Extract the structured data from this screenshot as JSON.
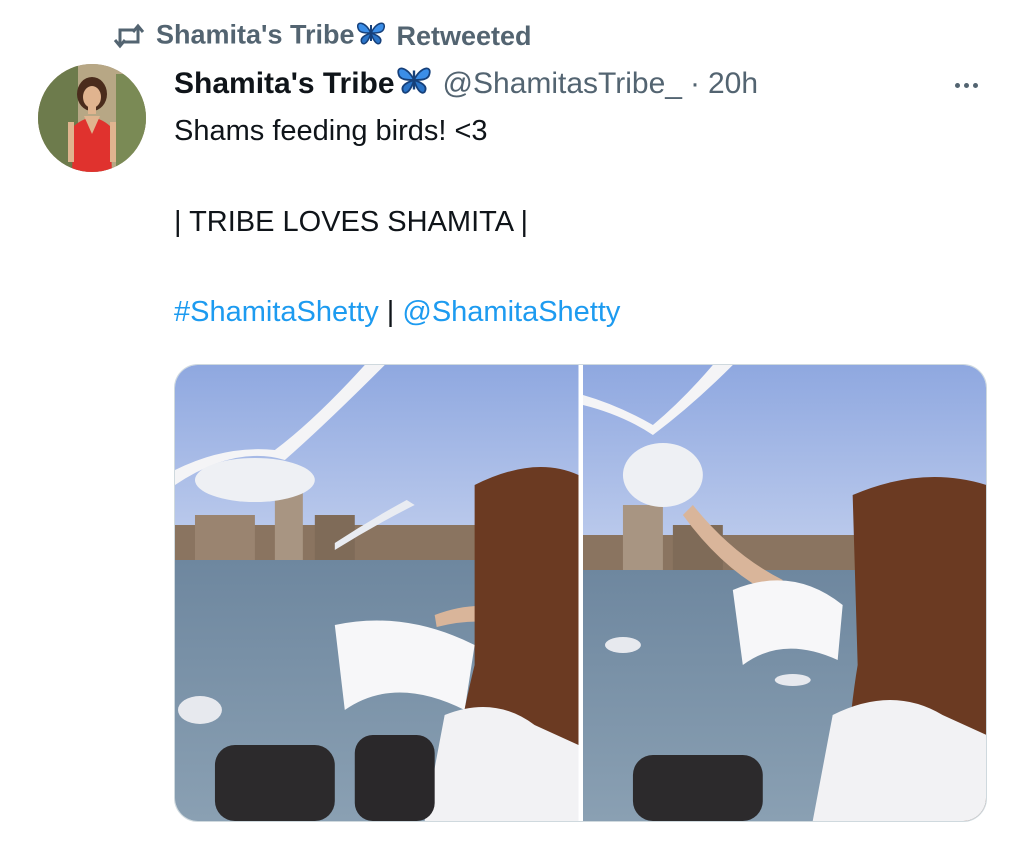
{
  "retweet": {
    "icon": "retweet-icon",
    "account_name": "Shamita's Tribe",
    "label": "Retweeted"
  },
  "tweet": {
    "avatar_icon": "avatar",
    "display_name": "Shamita's Tribe",
    "handle": "@ShamitasTribe_",
    "separator": "·",
    "time": "20h",
    "more_icon": "more-icon",
    "text_line1": "Shams feeding birds! <3",
    "text_line2": "| TRIBE LOVES SHAMITA |",
    "hashtag": "#ShamitaShetty",
    "pipe": " | ",
    "mention": "@ShamitaShetty",
    "emoji": "butterfly-icon"
  },
  "colors": {
    "link": "#1d9bf0",
    "secondary": "#536471",
    "butterfly": "#1d6fd6"
  }
}
